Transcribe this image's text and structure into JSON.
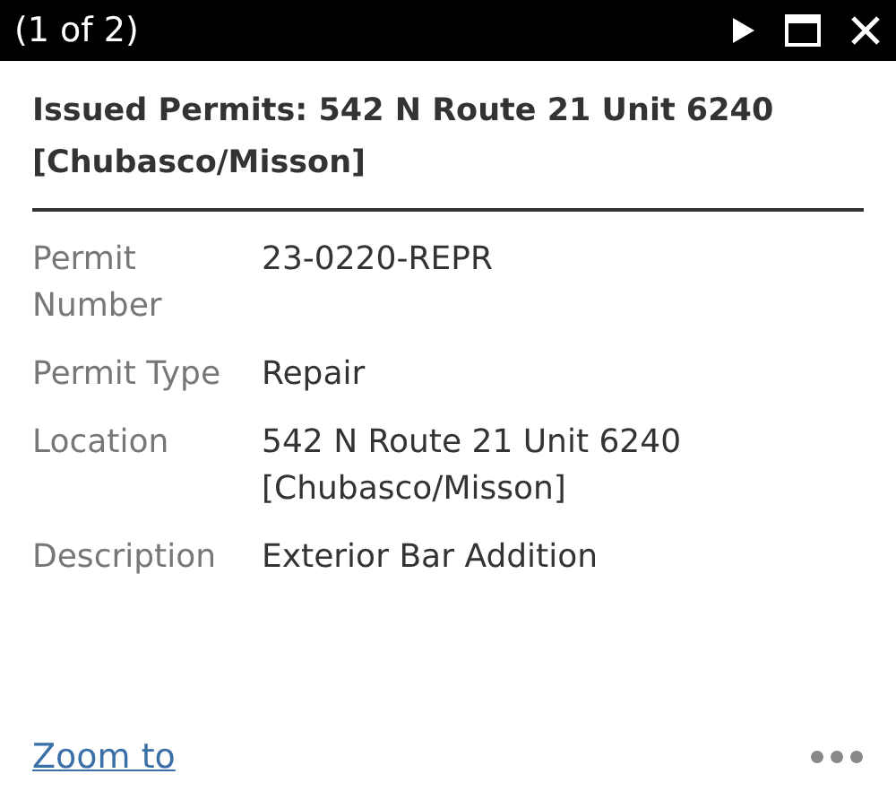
{
  "header": {
    "title": "(1 of 2)"
  },
  "popup": {
    "title": "Issued Permits: 542 N Route 21 Unit 6240 [Chubasco/Misson]",
    "fields": [
      {
        "label": "Permit Number",
        "value": "23-0220-REPR"
      },
      {
        "label": "Permit Type",
        "value": "Repair"
      },
      {
        "label": "Location",
        "value": "542 N Route 21 Unit 6240 [Chubasco/Misson]"
      },
      {
        "label": "Description",
        "value": "Exterior Bar Addition"
      }
    ]
  },
  "footer": {
    "link": "Zoom to"
  }
}
